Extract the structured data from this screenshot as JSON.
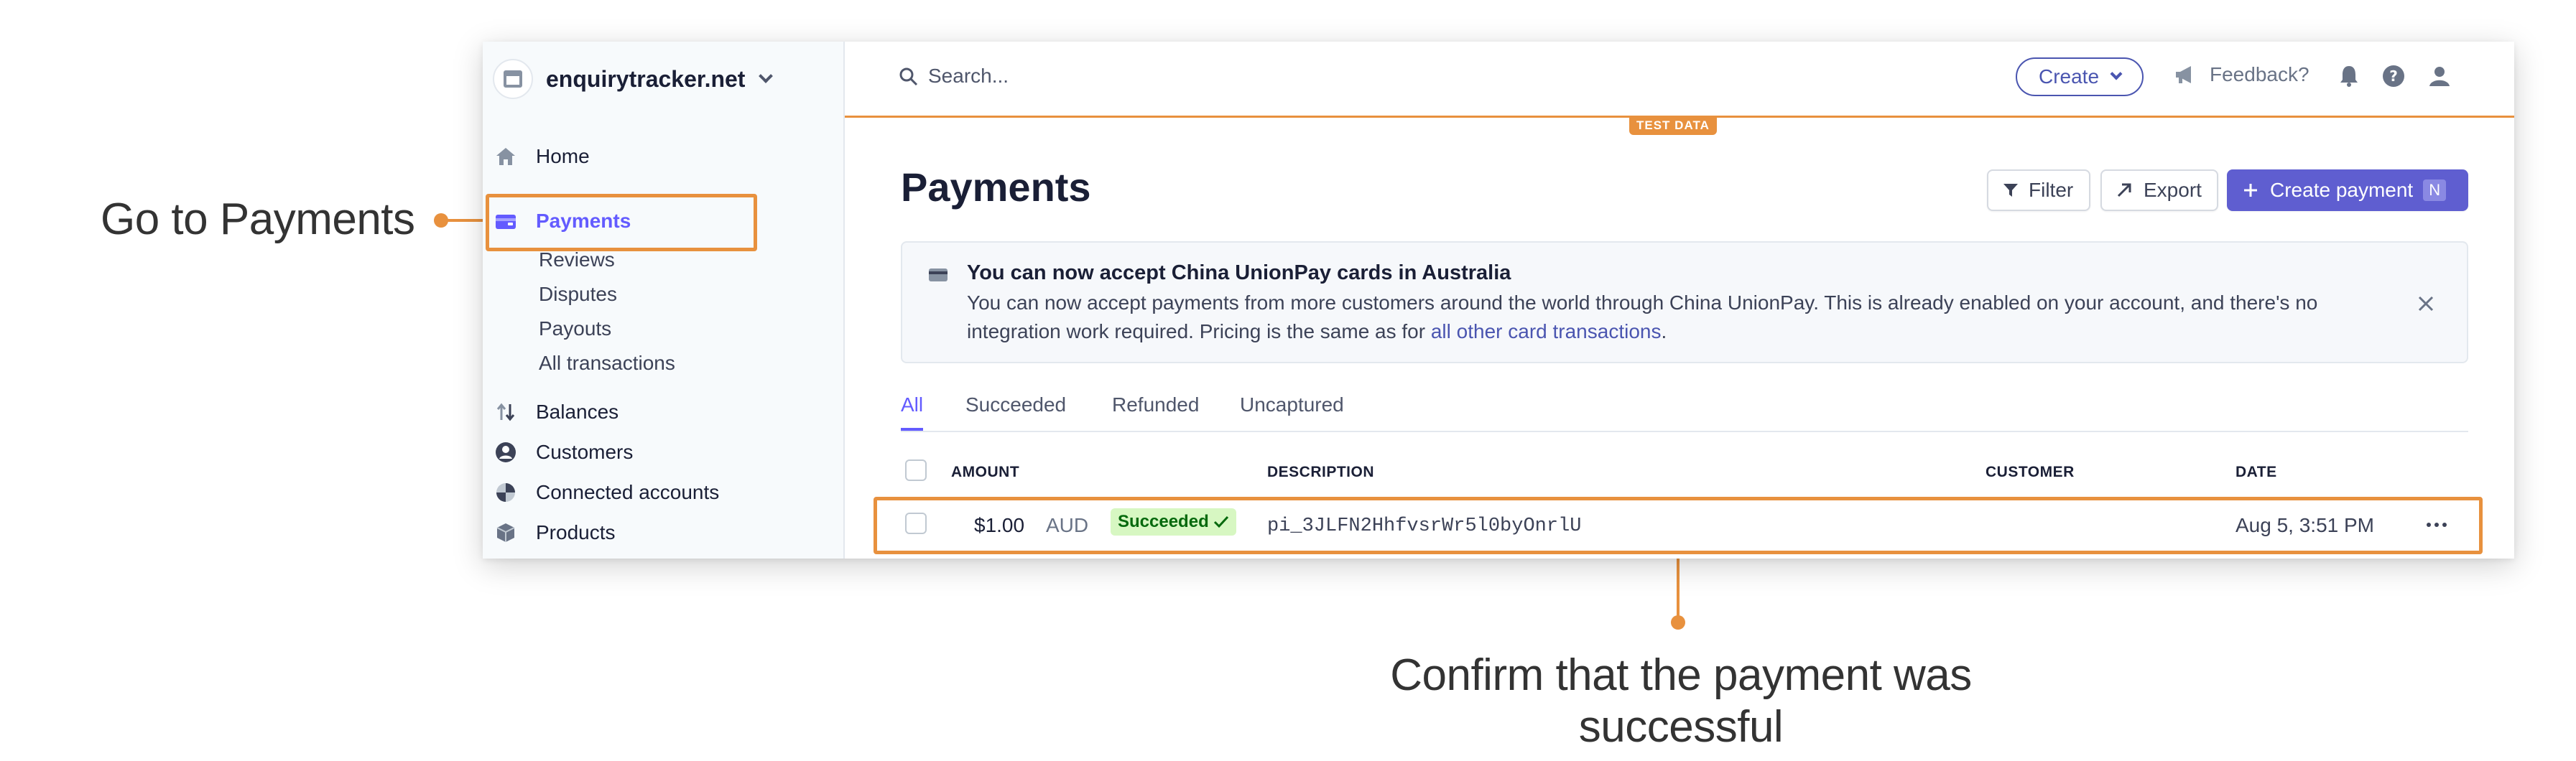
{
  "annotations": {
    "left": "Go to Payments",
    "bottom": "Confirm that the payment was successful"
  },
  "sidebar": {
    "account_name": "enquirytracker.net",
    "items": [
      {
        "label": "Home",
        "icon": "home-icon"
      },
      {
        "label": "Payments",
        "icon": "payments-icon"
      },
      {
        "label": "Balances",
        "icon": "balances-icon"
      },
      {
        "label": "Customers",
        "icon": "customers-icon"
      },
      {
        "label": "Connected accounts",
        "icon": "connected-accounts-icon"
      },
      {
        "label": "Products",
        "icon": "products-icon"
      }
    ],
    "sub_items": [
      "Reviews",
      "Disputes",
      "Payouts",
      "All transactions"
    ]
  },
  "topbar": {
    "search_placeholder": "Search...",
    "create_label": "Create",
    "feedback_label": "Feedback?",
    "test_badge": "TEST DATA"
  },
  "page": {
    "title": "Payments",
    "filter_label": "Filter",
    "export_label": "Export",
    "create_payment_label": "Create payment",
    "create_payment_shortcut": "N"
  },
  "banner": {
    "title": "You can now accept China UnionPay cards in Australia",
    "body": "You can now accept payments from more customers around the world through China UnionPay. This is already enabled on your account, and there's no integration work required. Pricing is the same as for ",
    "link": "all other card transactions",
    "end": "."
  },
  "tabs": [
    "All",
    "Succeeded",
    "Refunded",
    "Uncaptured"
  ],
  "table": {
    "headers": {
      "amount": "AMOUNT",
      "description": "DESCRIPTION",
      "customer": "CUSTOMER",
      "date": "DATE"
    },
    "rows": [
      {
        "amount": "$1.00",
        "currency": "AUD",
        "status": "Succeeded",
        "description": "pi_3JLFN2HhfvsrWr5l0byOnrlU",
        "customer": "",
        "date": "Aug 5, 3:51 PM"
      }
    ]
  },
  "colors": {
    "accent": "#635bff",
    "annotation": "#e8913e",
    "success_bg": "#d7f7c2",
    "success_text": "#05690d"
  }
}
